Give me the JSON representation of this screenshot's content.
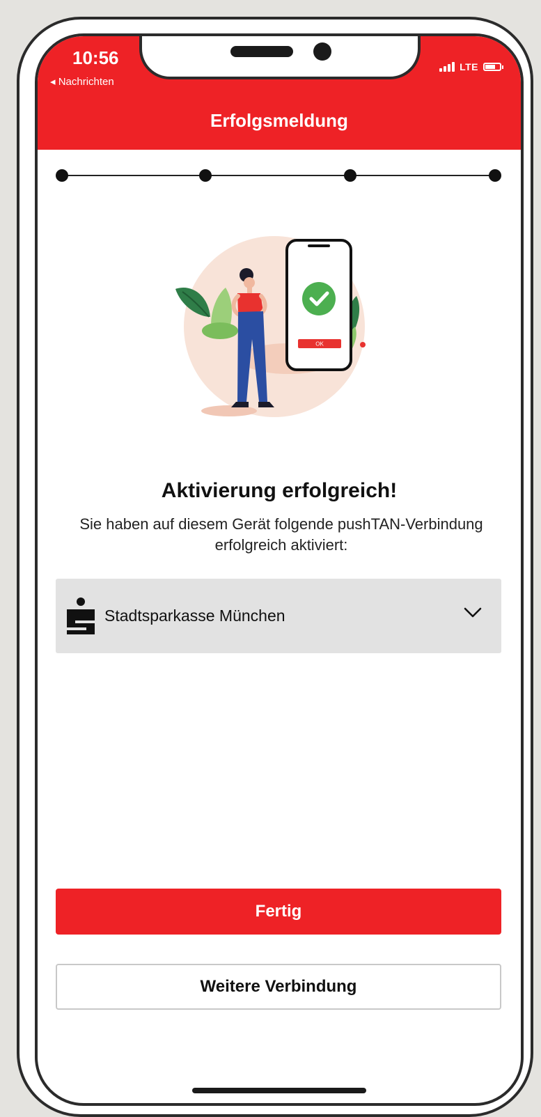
{
  "status_bar": {
    "time": "10:56",
    "back_label": "◂ Nachrichten",
    "network": "LTE"
  },
  "header": {
    "title": "Erfolgsmeldung"
  },
  "stepper": {
    "steps": 4,
    "current": 4
  },
  "illustration": {
    "ok_label": "OK"
  },
  "main": {
    "heading": "Aktivierung erfolgreich!",
    "description": "Sie haben auf diesem Gerät folgende pushTAN-Verbindung erfolgreich aktiviert:"
  },
  "connection": {
    "name": "Stadtsparkasse München"
  },
  "buttons": {
    "primary": "Fertig",
    "secondary": "Weitere Verbindung"
  },
  "colors": {
    "brand_red": "#ee2226",
    "card_gray": "#e2e2e2"
  }
}
